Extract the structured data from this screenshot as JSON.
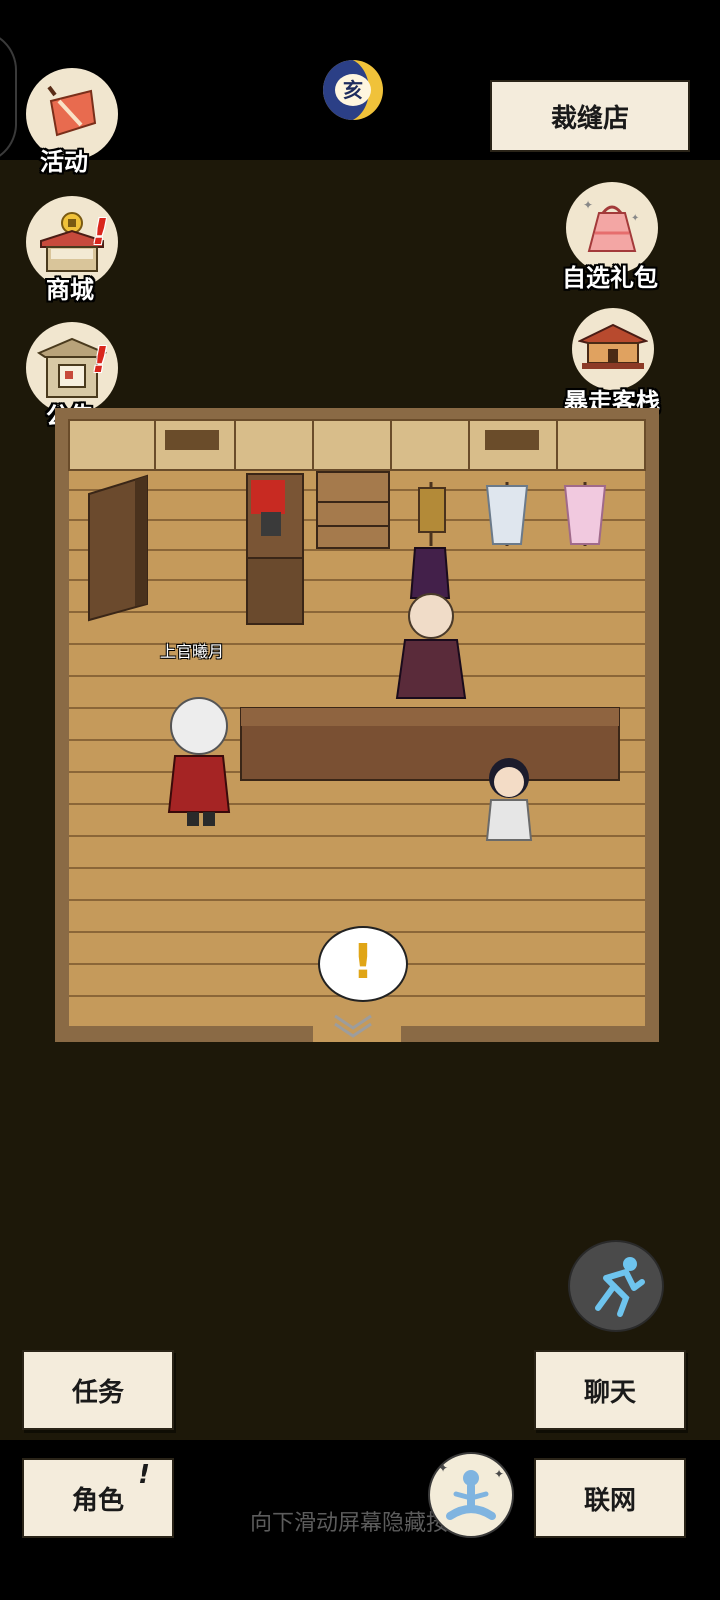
{
  "location": {
    "name": "裁缝店"
  },
  "time_badge": {
    "glyph": "亥"
  },
  "left_menu": [
    {
      "label": "活动"
    },
    {
      "label": "商城",
      "alert": "!"
    },
    {
      "label": "公告",
      "alert": "!"
    }
  ],
  "right_menu": [
    {
      "label": "自选礼包"
    },
    {
      "label": "暴走客栈"
    }
  ],
  "scene": {
    "npc_name": "上官曦月",
    "speech_bubble": "!"
  },
  "buttons": {
    "tasks": "任务",
    "chat": "聊天",
    "character": "角色",
    "character_alert": "!",
    "network": "联网"
  },
  "hint_text": "向下滑动屏幕隐藏按钮",
  "colors": {
    "background": "#1d1809",
    "paper": "#f4ecdc",
    "alert": "#d9261c",
    "floor": "#c59a5b"
  }
}
